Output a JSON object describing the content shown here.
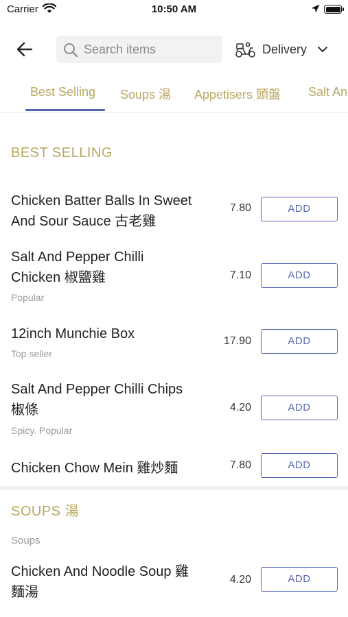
{
  "status_bar": {
    "carrier": "Carrier",
    "time": "10:50 AM"
  },
  "header": {
    "search_placeholder": "Search items",
    "delivery_label": "Delivery"
  },
  "tabs": [
    {
      "label": "Best Selling",
      "active": true
    },
    {
      "label": "Soups 湯",
      "active": false
    },
    {
      "label": "Appetisers 頭盤",
      "active": false
    },
    {
      "label": "Salt An",
      "active": false
    }
  ],
  "best_selling": {
    "title": "BEST SELLING",
    "items": [
      {
        "name_line1": "Chicken Batter Balls In Sweet",
        "name_line2": "And Sour Sauce 古老雞",
        "tag": "",
        "price": "7.80",
        "button": "ADD"
      },
      {
        "name_line1": "Salt And Pepper Chilli",
        "name_line2": "Chicken 椒鹽雞",
        "tag": "Popular",
        "price": "7.10",
        "button": "ADD"
      },
      {
        "name_line1": "12inch Munchie Box",
        "name_line2": "",
        "tag": "Top seller",
        "price": "17.90",
        "button": "ADD"
      },
      {
        "name_line1": "Salt And Pepper Chilli Chips",
        "name_line2": "椒條",
        "tag": "Spicy. Popular",
        "price": "4.20",
        "button": "ADD"
      },
      {
        "name_line1": "Chicken Chow Mein 雞炒麵",
        "name_line2": "",
        "tag": "",
        "price": "7.80",
        "button": "ADD"
      }
    ]
  },
  "soups": {
    "title": "SOUPS 湯",
    "subtitle": "Soups",
    "items": [
      {
        "name_line1": "Chicken And Noodle Soup 雞",
        "name_line2": "麵湯",
        "price": "4.20",
        "button": "ADD"
      }
    ]
  },
  "colors": {
    "accent_gold": "#b9a860",
    "accent_blue": "#5666b3"
  }
}
